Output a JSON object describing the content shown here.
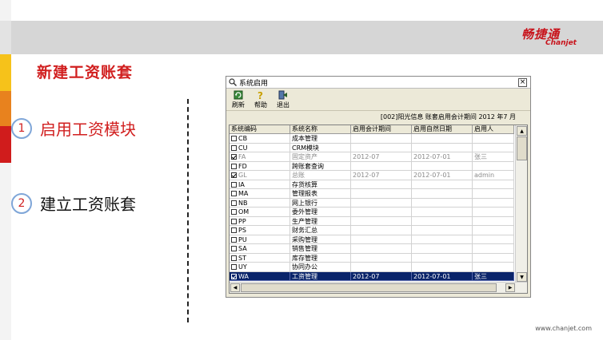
{
  "slide": {
    "title": "新建工资账套",
    "steps": [
      {
        "num": "1",
        "label": "启用工资模块"
      },
      {
        "num": "2",
        "label": "建立工资账套"
      }
    ],
    "footer_url": "www.chanjet.com"
  },
  "logo": {
    "cn": "畅捷通",
    "en": "Chanjet",
    "color": "#c8141c"
  },
  "dialog": {
    "title": "系统启用",
    "close": "×",
    "toolbar": [
      {
        "label": "刷新",
        "icon": "refresh-icon"
      },
      {
        "label": "帮助",
        "icon": "help-icon"
      },
      {
        "label": "退出",
        "icon": "exit-icon"
      }
    ],
    "info": "[002]阳光信息 账套启用会计期间 2012 年7 月",
    "columns": [
      "系统编码",
      "系统名称",
      "启用会计期间",
      "启用自然日期",
      "启用人"
    ],
    "rows": [
      {
        "code": "CB",
        "name": "成本管理",
        "period": "",
        "date": "",
        "user": "",
        "checked": false,
        "gray": false,
        "selected": false
      },
      {
        "code": "CU",
        "name": "CRM模块",
        "period": "",
        "date": "",
        "user": "",
        "checked": false,
        "gray": false,
        "selected": false
      },
      {
        "code": "FA",
        "name": "固定资产",
        "period": "2012-07",
        "date": "2012-07-01",
        "user": "张三",
        "checked": true,
        "gray": true,
        "selected": false
      },
      {
        "code": "FD",
        "name": "跨账套查询",
        "period": "",
        "date": "",
        "user": "",
        "checked": false,
        "gray": false,
        "selected": false
      },
      {
        "code": "GL",
        "name": "总账",
        "period": "2012-07",
        "date": "2012-07-01",
        "user": "admin",
        "checked": true,
        "gray": true,
        "selected": false
      },
      {
        "code": "IA",
        "name": "存货核算",
        "period": "",
        "date": "",
        "user": "",
        "checked": false,
        "gray": false,
        "selected": false
      },
      {
        "code": "MA",
        "name": "管理报表",
        "period": "",
        "date": "",
        "user": "",
        "checked": false,
        "gray": false,
        "selected": false
      },
      {
        "code": "NB",
        "name": "网上银行",
        "period": "",
        "date": "",
        "user": "",
        "checked": false,
        "gray": false,
        "selected": false
      },
      {
        "code": "OM",
        "name": "委外管理",
        "period": "",
        "date": "",
        "user": "",
        "checked": false,
        "gray": false,
        "selected": false
      },
      {
        "code": "PP",
        "name": "生产管理",
        "period": "",
        "date": "",
        "user": "",
        "checked": false,
        "gray": false,
        "selected": false
      },
      {
        "code": "PS",
        "name": "财务汇总",
        "period": "",
        "date": "",
        "user": "",
        "checked": false,
        "gray": false,
        "selected": false
      },
      {
        "code": "PU",
        "name": "采购管理",
        "period": "",
        "date": "",
        "user": "",
        "checked": false,
        "gray": false,
        "selected": false
      },
      {
        "code": "SA",
        "name": "销售管理",
        "period": "",
        "date": "",
        "user": "",
        "checked": false,
        "gray": false,
        "selected": false
      },
      {
        "code": "ST",
        "name": "库存管理",
        "period": "",
        "date": "",
        "user": "",
        "checked": false,
        "gray": false,
        "selected": false
      },
      {
        "code": "UY",
        "name": "协同办公",
        "period": "",
        "date": "",
        "user": "",
        "checked": false,
        "gray": false,
        "selected": false
      },
      {
        "code": "WA",
        "name": "工资管理",
        "period": "2012-07",
        "date": "2012-07-01",
        "user": "张三",
        "checked": true,
        "gray": false,
        "selected": true
      }
    ],
    "selection_color": "#0a246a"
  }
}
